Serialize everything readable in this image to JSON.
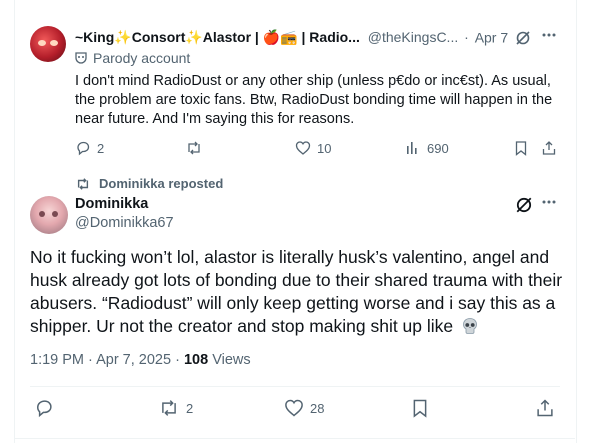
{
  "parent_tweet": {
    "author_name": "~King✨Consort✨Alastor | 🍎📻 | Radio...",
    "handle": "@theKingsC...",
    "separator": "·",
    "date": "Apr 7",
    "label": "Parody account",
    "text": "I don't mind RadioDust or any other ship (unless p€do or inc€st). As usual, the problem are toxic fans. Btw, RadioDust bonding time will happen in the near future. And I'm saying this for reasons.",
    "replies": "2",
    "likes": "10",
    "views": "690"
  },
  "repost": {
    "text": "Dominikka reposted"
  },
  "main_tweet": {
    "author_name": "Dominikka",
    "handle": "@Dominikka67",
    "text": "No it fucking won’t lol, alastor is literally husk’s valentino, angel and husk already got lots of bonding due to their shared trauma with their abusers. “Radiodust” will  only keep getting worse and i say this as a shipper. Ur not the creator and stop making shit up like",
    "time": "1:19 PM · Apr 7, 2025 ·",
    "views_count": "108",
    "views_label": "Views",
    "reposts": "2",
    "likes": "28"
  },
  "colors": {
    "text": "#0f1419",
    "secondary": "#536471",
    "border": "#eff3f4"
  }
}
